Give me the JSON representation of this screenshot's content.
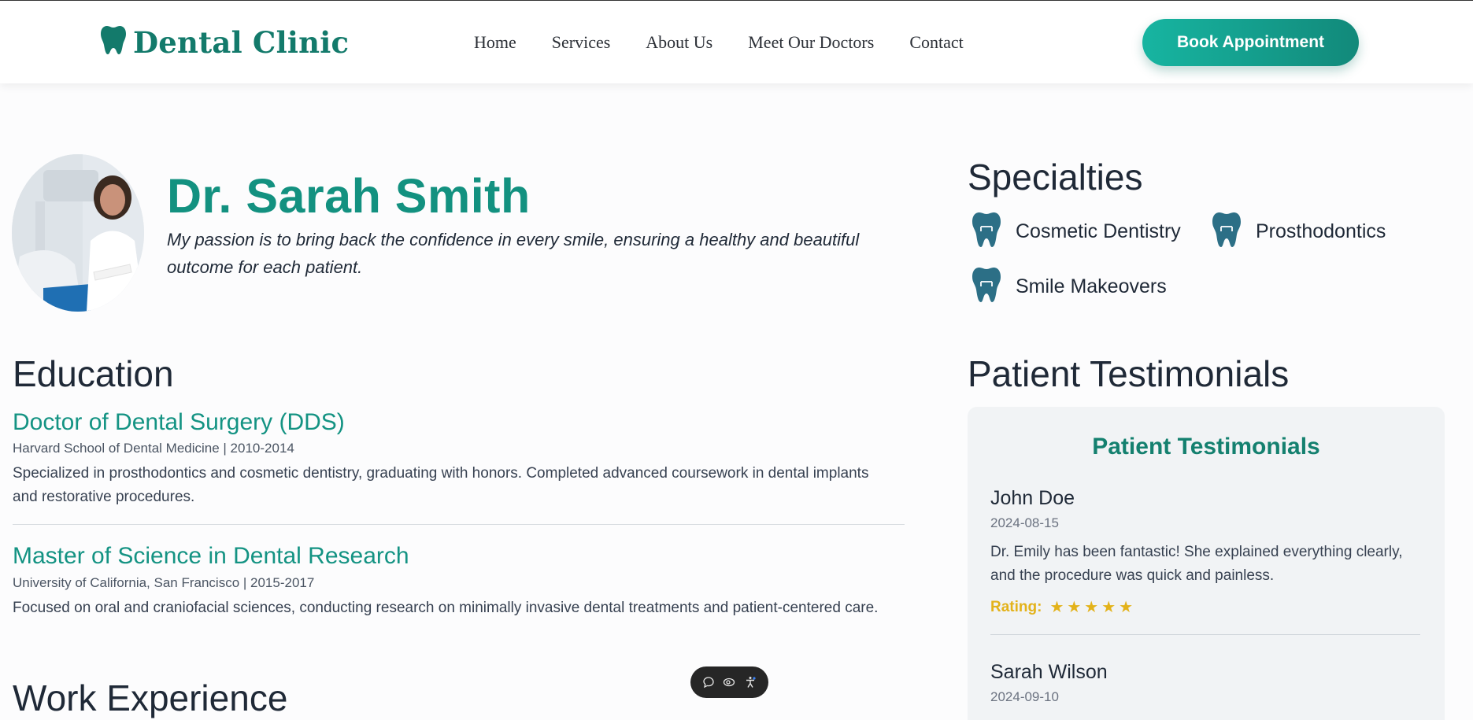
{
  "header": {
    "logo_text": "Dental Clinic",
    "logo_icon": "tooth-icon",
    "nav": [
      "Home",
      "Services",
      "About Us",
      "Meet Our Doctors",
      "Contact"
    ],
    "cta_label": "Book Appointment"
  },
  "doctor": {
    "name": "Dr. Sarah Smith",
    "quote": "My passion is to bring back the confidence in every smile, ensuring a healthy and beautiful outcome for each patient."
  },
  "education": {
    "heading": "Education",
    "items": [
      {
        "title": "Doctor of Dental Surgery (DDS)",
        "meta": "Harvard School of Dental Medicine | 2010-2014",
        "description": "Specialized in prosthodontics and cosmetic dentistry, graduating with honors. Completed advanced coursework in dental implants and restorative procedures."
      },
      {
        "title": "Master of Science in Dental Research",
        "meta": "University of California, San Francisco | 2015-2017",
        "description": "Focused on oral and craniofacial sciences, conducting research on minimally invasive dental treatments and patient-centered care."
      }
    ]
  },
  "work": {
    "heading": "Work Experience"
  },
  "specialties": {
    "heading": "Specialties",
    "items": [
      "Cosmetic Dentistry",
      "Prosthodontics",
      "Smile Makeovers"
    ]
  },
  "testimonials": {
    "heading": "Patient Testimonials",
    "card_title": "Patient Testimonials",
    "rating_label": "Rating:",
    "items": [
      {
        "name": "John Doe",
        "date": "2024-08-15",
        "text": "Dr. Emily has been fantastic! She explained everything clearly, and the procedure was quick and painless.",
        "stars": "★★★★★",
        "rating": 5
      },
      {
        "name": "Sarah Wilson",
        "date": "2024-09-10"
      }
    ]
  },
  "colors": {
    "brand": "#137a6b",
    "accent": "#17b5a1",
    "tooth_icon": "#2c6f86",
    "star": "#e3b21a"
  }
}
